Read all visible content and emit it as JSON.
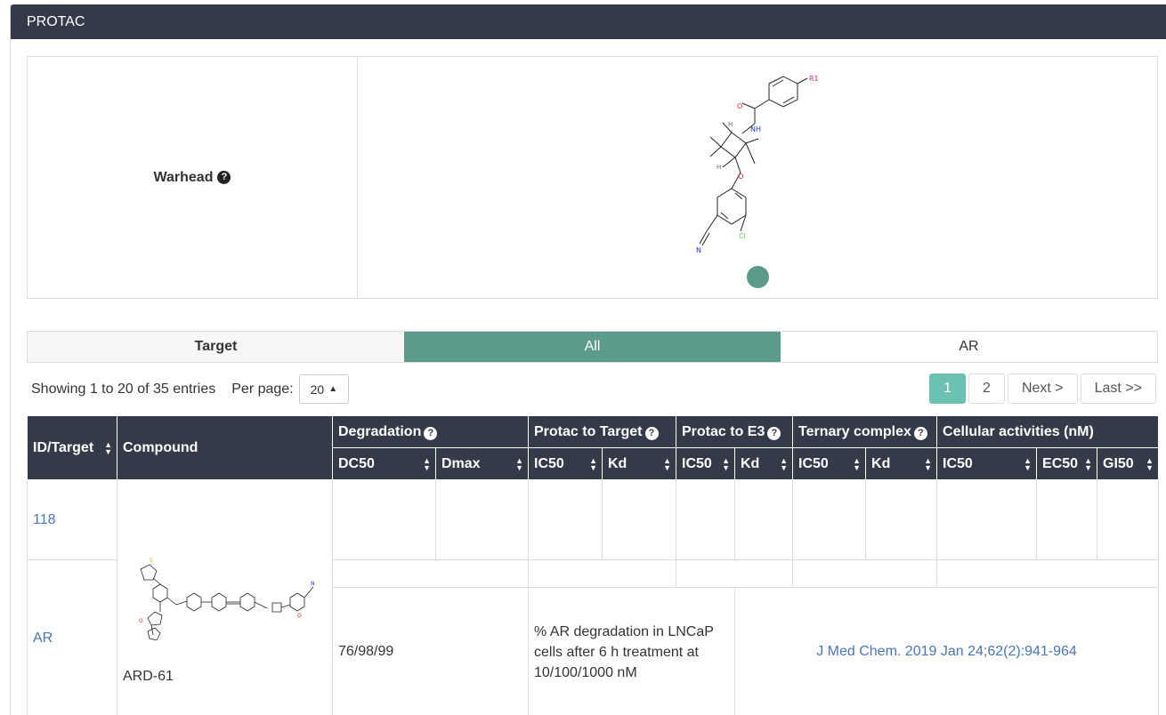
{
  "panel": {
    "title": "PROTAC"
  },
  "warhead": {
    "label": "Warhead",
    "help_icon": "question-circle-icon"
  },
  "tabs": [
    {
      "label": "Target"
    },
    {
      "label": "All"
    },
    {
      "label": "AR"
    }
  ],
  "info": {
    "showing": "Showing 1 to 20 of 35 entries",
    "per_page_label": "Per page:",
    "per_page_value": "20"
  },
  "pager": {
    "pages": [
      "1",
      "2"
    ],
    "next": "Next >",
    "last": "Last >>",
    "active_page": "1"
  },
  "table": {
    "headers": {
      "id_target": "ID/Target",
      "compound": "Compound",
      "degradation": "Degradation",
      "protac_target": "Protac to Target",
      "protac_e3": "Protac to E3",
      "ternary": "Ternary complex",
      "cellular": "Cellular activities (nM)"
    },
    "subheaders": [
      "DC50",
      "Dmax",
      "IC50",
      "Kd",
      "IC50",
      "Kd",
      "IC50",
      "Kd",
      "IC50",
      "EC50",
      "GI50"
    ],
    "rows": {
      "id": "118",
      "target": "AR",
      "compound_name": "ARD-61",
      "degradation_values": "76/98/99",
      "description": "% AR degradation in LNCaP cells after 6 h treatment at 10/100/1000 nM",
      "reference": "J Med Chem. 2019 Jan 24;62(2):941-964"
    }
  },
  "colors": {
    "header_bg": "#343a48",
    "accent": "#5a9b8b",
    "page_active": "#6bc2b0",
    "link": "#4a76b5"
  }
}
